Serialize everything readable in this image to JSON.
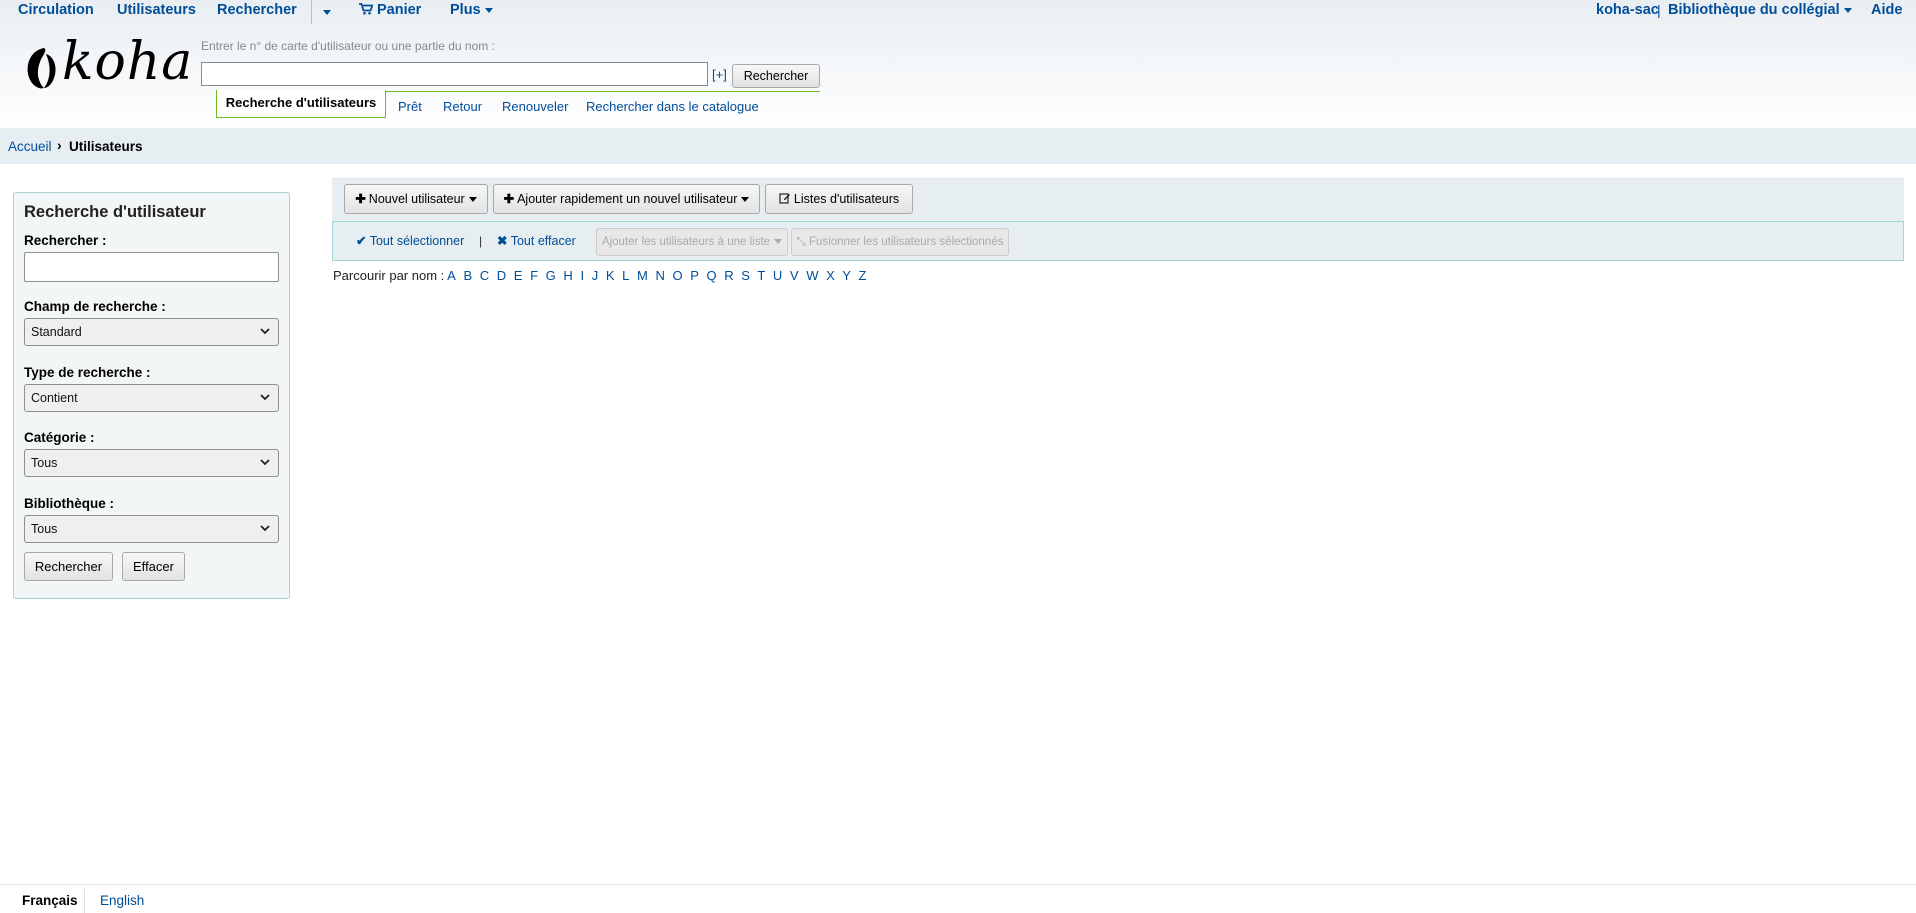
{
  "topnav": {
    "circulation": "Circulation",
    "patrons": "Utilisateurs",
    "search": "Rechercher",
    "cart": "Panier",
    "more": "Plus",
    "user": "koha-sac",
    "pipe": "|",
    "library": "Bibliothèque du collégial",
    "help": "Aide"
  },
  "logo": {
    "wordmark": "koha"
  },
  "header_search": {
    "hint": "Entrer le n° de carte d'utilisateur ou une partie du nom :",
    "value": "",
    "advanced_toggle": "[+]",
    "button": "Rechercher"
  },
  "subtabs": {
    "active": "Recherche d'utilisateurs",
    "items": [
      "Prêt",
      "Retour",
      "Renouveler",
      "Rechercher dans le catalogue"
    ]
  },
  "breadcrumb": {
    "home": "Accueil",
    "separator": "›",
    "current": "Utilisateurs"
  },
  "sidebar": {
    "title": "Recherche d'utilisateur",
    "search_label": "Rechercher :",
    "search_value": "",
    "field_label": "Champ de recherche :",
    "field_value": "Standard",
    "type_label": "Type de recherche :",
    "type_value": "Contient",
    "category_label": "Catégorie :",
    "category_value": "Tous",
    "library_label": "Bibliothèque :",
    "library_value": "Tous",
    "search_button": "Rechercher",
    "clear_button": "Effacer"
  },
  "toolbar": {
    "new_patron": "Nouvel utilisateur",
    "quick_add": "Ajouter rapidement un nouvel utilisateur",
    "patron_lists": "Listes d'utilisateurs"
  },
  "selection": {
    "select_all": "Tout sélectionner",
    "clear_all": "Tout effacer",
    "pipe": "|",
    "add_to_list": "Ajouter les utilisateurs à une liste",
    "merge": "Fusionner les utilisateurs sélectionnés"
  },
  "browse": {
    "label": "Parcourir par nom :",
    "letters": [
      "A",
      "B",
      "C",
      "D",
      "E",
      "F",
      "G",
      "H",
      "I",
      "J",
      "K",
      "L",
      "M",
      "N",
      "O",
      "P",
      "Q",
      "R",
      "S",
      "T",
      "U",
      "V",
      "W",
      "X",
      "Y",
      "Z"
    ]
  },
  "footer": {
    "lang_current": "Français",
    "lang_other": "English"
  },
  "colors": {
    "link": "#004d99",
    "accent_green": "#6dbb2a",
    "panel_border": "#a6d5d6",
    "bar_bg": "#e6eef2"
  },
  "icons": {
    "cart": "cart-icon",
    "plus": "plus-icon",
    "edit": "edit-icon",
    "check": "check-icon",
    "times": "times-icon",
    "merge": "merge-icon"
  }
}
